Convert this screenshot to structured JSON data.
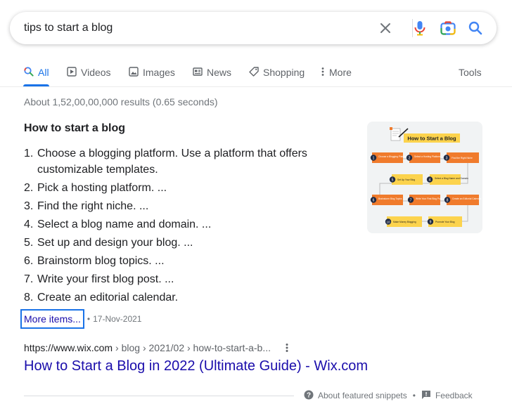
{
  "search": {
    "query": "tips to start a blog"
  },
  "colors": {
    "link_blue": "#1a0dab",
    "accent_blue": "#1a73e8",
    "text_gray": "#70757a"
  },
  "icons": {
    "clear": "close-icon",
    "voice": "microphone-icon",
    "lens": "camera-icon",
    "search": "search-icon"
  },
  "tabs": [
    {
      "label": "All",
      "icon": "search-icon",
      "active": true
    },
    {
      "label": "Videos",
      "icon": "play-icon"
    },
    {
      "label": "Images",
      "icon": "image-icon"
    },
    {
      "label": "News",
      "icon": "news-icon"
    },
    {
      "label": "Shopping",
      "icon": "tag-icon"
    },
    {
      "label": "More",
      "icon": "more-vert-icon"
    }
  ],
  "tools_label": "Tools",
  "result_stats": "About 1,52,00,00,000 results (0.65 seconds)",
  "snippet": {
    "title": "How to start a blog",
    "items": [
      {
        "num": "1.",
        "text": "Choose a blogging platform. Use a platform that offers customizable templates."
      },
      {
        "num": "2.",
        "text": "Pick a hosting platform. ..."
      },
      {
        "num": "3.",
        "text": "Find the right niche. ..."
      },
      {
        "num": "4.",
        "text": "Select a blog name and domain. ..."
      },
      {
        "num": "5.",
        "text": "Set up and design your blog. ..."
      },
      {
        "num": "6.",
        "text": "Brainstorm blog topics. ..."
      },
      {
        "num": "7.",
        "text": "Write your first blog post. ..."
      },
      {
        "num": "8.",
        "text": "Create an editorial calendar."
      }
    ],
    "more_items": "More items...",
    "date": "17-Nov-2021",
    "image": {
      "heading": "How to Start a Blog",
      "steps": [
        {
          "n": "1",
          "text": "Choose a Blogging Platform"
        },
        {
          "n": "2",
          "text": "Select a Hosting Platform"
        },
        {
          "n": "3",
          "text": "Find the Right Niche"
        },
        {
          "n": "4",
          "text": "Select a Blog Name and Domain"
        },
        {
          "n": "5",
          "text": "Set Up Your Blog"
        },
        {
          "n": "6",
          "text": "Brainstorm Blog Topics"
        },
        {
          "n": "7",
          "text": "Write Your First Blog Post"
        },
        {
          "n": "8",
          "text": "Create an Editorial Calendar"
        },
        {
          "n": "9",
          "text": "Promote Your Blog"
        },
        {
          "n": "10",
          "text": "Make Money Blogging"
        }
      ]
    }
  },
  "result": {
    "domain": "https://www.wix.com",
    "path": "› blog › 2021/02 › how-to-start-a-b...",
    "title": "How to Start a Blog in 2022 (Ultimate Guide) - Wix.com"
  },
  "footer": {
    "about": "About featured snippets",
    "feedback": "Feedback"
  }
}
